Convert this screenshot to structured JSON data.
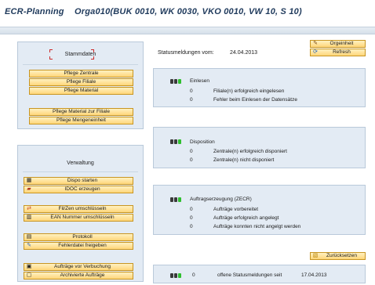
{
  "title": {
    "app": "ECR-Planning",
    "context": "Orga010(BUK 0010, WK 0030, VKO 0010, VW 10, S 10)"
  },
  "stammdaten": {
    "heading": "Stammdaten",
    "buttons": [
      "Pflege Zentrale",
      "Pflege Filiale",
      "Pflege Material",
      "Pflege Material zur Filiale",
      "Pflege Mengeneinheit"
    ]
  },
  "verwaltung": {
    "heading": "Verwaltung",
    "buttons": [
      {
        "label": "Dispo starten",
        "icon": "calendar-icon"
      },
      {
        "label": "IDOC erzeugen",
        "icon": "truck-icon"
      },
      {
        "label": "Fil/Zen umschlüsseln",
        "icon": "swap-arrows-icon"
      },
      {
        "label": "EAN Nummer umschlüsseln",
        "icon": "barcode-icon"
      },
      {
        "label": "Protokoll",
        "icon": "log-icon"
      },
      {
        "label": "Fehlerdatei freigeben",
        "icon": "pencil-icon"
      },
      {
        "label": "Aufträge vor Verbuchung",
        "icon": "orders-icon"
      },
      {
        "label": "Archivierte Aufträge",
        "icon": "archive-icon"
      }
    ]
  },
  "top_buttons": {
    "orgeinheit": "Orgeinheit",
    "refresh": "Refresh",
    "zuruecksetzen": "Zurücksetzen"
  },
  "status": {
    "label": "Statusmeldungen vom:",
    "date": "24.04.2013"
  },
  "einlesen": {
    "title": "Einlesen",
    "rows": [
      {
        "count": "0",
        "text": "Filiale(n) erfolgreich eingelesen"
      },
      {
        "count": "0",
        "text": "Fehler beim Einlesen der Datensätze"
      }
    ]
  },
  "disposition": {
    "title": "Disposition",
    "rows": [
      {
        "count": "0",
        "text": "Zentrale(n) erfolgreich disponiert"
      },
      {
        "count": "0",
        "text": "Zentrale(n) nicht disponiert"
      }
    ]
  },
  "auftrag": {
    "title": "Auftragserzeugung (ZECR)",
    "rows": [
      {
        "count": "0",
        "text": "Aufträge vorbereitet"
      },
      {
        "count": "0",
        "text": "Aufträge erfolgreich angelegt"
      },
      {
        "count": "0",
        "text": "Aufträge konnten nicht angelgt werden"
      }
    ]
  },
  "offene": {
    "count": "0",
    "text": "offene Statusmeldungen seit",
    "date": "17.04.2013"
  },
  "colors": {
    "button_fill": "#ffd67a",
    "button_border": "#c89522",
    "panel_bg": "#e3ebf4",
    "title_blue": "#1f3a5c",
    "lamp_green": "#2fbf2f",
    "bracket_red": "#cc2a2a"
  }
}
